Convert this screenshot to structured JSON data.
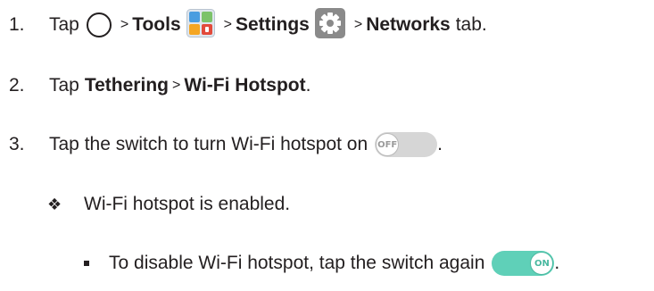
{
  "steps": [
    {
      "number": "1.",
      "tap": "Tap",
      "gt": ">",
      "tools": "Tools",
      "settings": "Settings",
      "networks": "Networks",
      "tab": "tab."
    },
    {
      "number": "2.",
      "tap": "Tap",
      "tethering": "Tethering",
      "gt": ">",
      "hotspot": "Wi-Fi Hotspot",
      "period": "."
    },
    {
      "number": "3.",
      "text": "Tap the switch to turn Wi-Fi hotspot on",
      "toggle_label": "OFF",
      "period": "."
    }
  ],
  "result": {
    "bullet": "❖",
    "text": "Wi-Fi hotspot is enabled."
  },
  "sub_bullet": {
    "text": "To disable Wi-Fi hotspot, tap the switch again",
    "toggle_label": "ON",
    "period": "."
  },
  "icons": [
    "home-circle-icon",
    "tools-folder-icon",
    "settings-gear-icon",
    "toggle-off-icon",
    "toggle-on-icon"
  ],
  "colors": {
    "text": "#231f20",
    "toggle_on": "#5fd0b8",
    "toggle_off": "#d6d6d6",
    "settings_bg": "#8a8a8a"
  }
}
